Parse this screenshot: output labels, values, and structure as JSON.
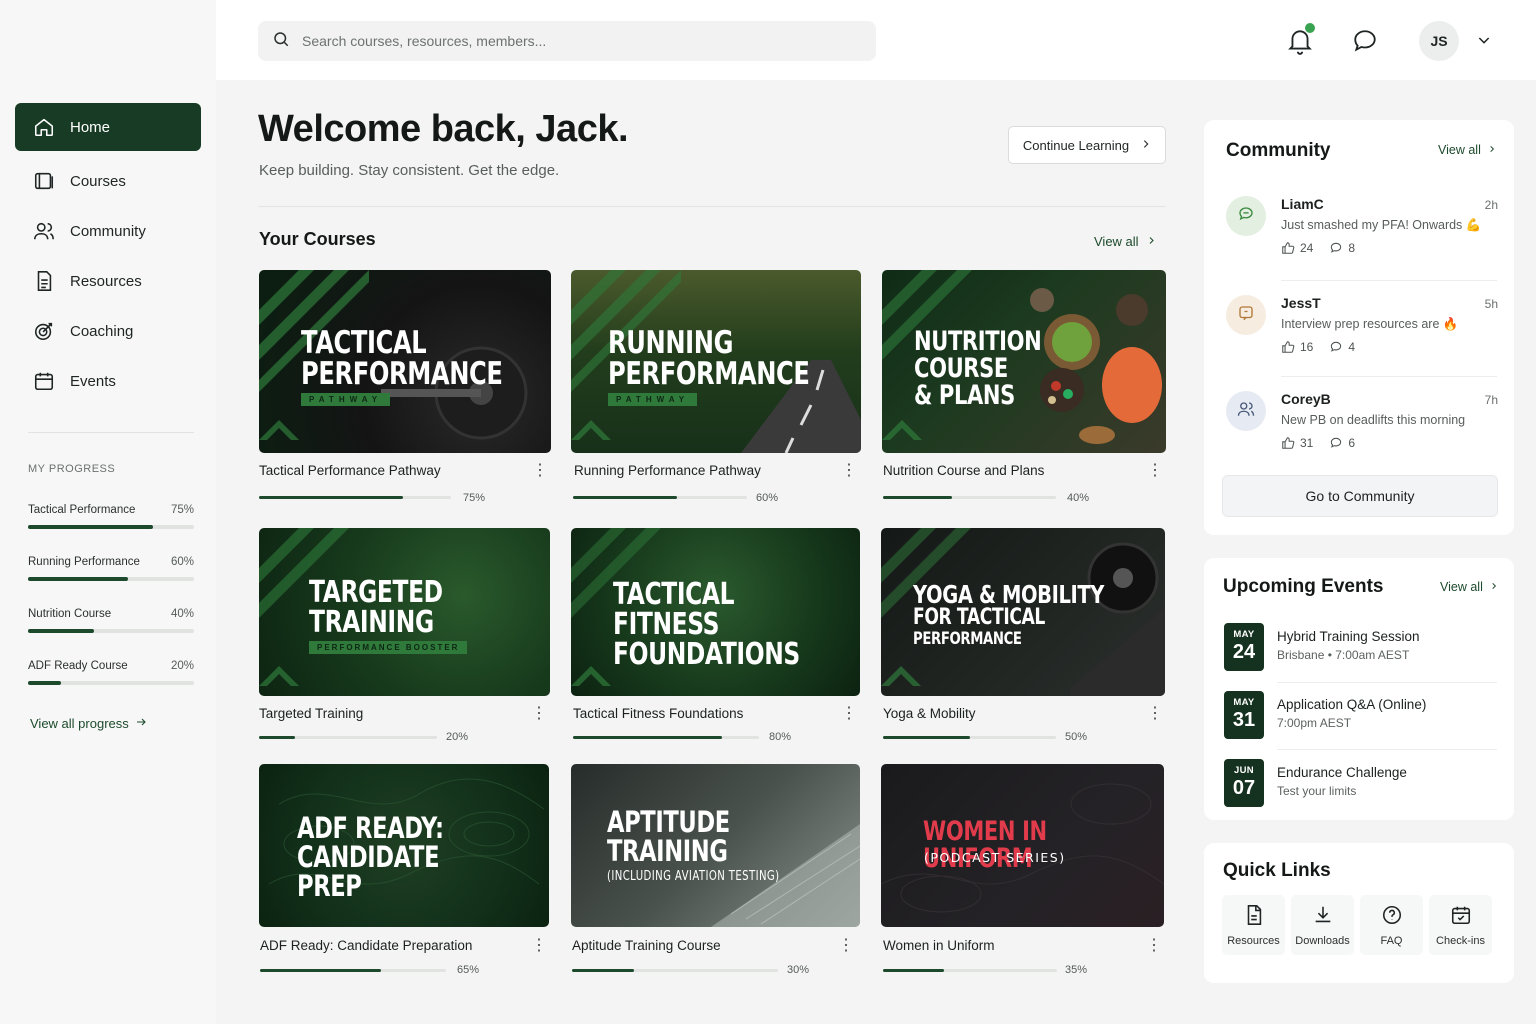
{
  "sidebar": {
    "nav": [
      {
        "label": "Home",
        "icon": "home-icon",
        "active": true
      },
      {
        "label": "Courses",
        "icon": "book-icon"
      },
      {
        "label": "Community",
        "icon": "users-icon"
      },
      {
        "label": "Resources",
        "icon": "document-icon"
      },
      {
        "label": "Coaching",
        "icon": "target-icon"
      },
      {
        "label": "Events",
        "icon": "calendar-icon"
      }
    ],
    "progress_heading": "MY PROGRESS",
    "progress": [
      {
        "label": "Tactical Performance",
        "pct_text": "75%",
        "value": 75
      },
      {
        "label": "Running Performance",
        "pct_text": "60%",
        "value": 60
      },
      {
        "label": "Nutrition Course",
        "pct_text": "40%",
        "value": 40
      },
      {
        "label": "ADF Ready Course",
        "pct_text": "20%",
        "value": 20
      }
    ],
    "view_progress": "View all progress"
  },
  "topbar": {
    "search_placeholder": "Search courses, resources, members...",
    "avatar_initials": "JS"
  },
  "main": {
    "welcome": "Welcome back, Jack.",
    "subtitle": "Keep building. Stay consistent. Get the edge.",
    "continue_label": "Continue Learning",
    "section_title": "Your Courses",
    "view_all": "View all",
    "courses": [
      {
        "thumb_lines": [
          "TACTICAL",
          "PERFORMANCE"
        ],
        "tag": "PATHWAY",
        "title": "Tactical Performance Pathway",
        "pct_text": "75%",
        "value": 75,
        "theme": "dark-green"
      },
      {
        "thumb_lines": [
          "RUNNING",
          "PERFORMANCE"
        ],
        "tag": "PATHWAY",
        "title": "Running Performance Pathway",
        "pct_text": "60%",
        "value": 60,
        "theme": "forest"
      },
      {
        "thumb_lines": [
          "NUTRITION",
          "COURSE",
          "& PLANS"
        ],
        "tag": "",
        "title": "Nutrition Course and Plans",
        "pct_text": "40%",
        "value": 40,
        "theme": "food"
      },
      {
        "thumb_lines": [
          "TARGETED",
          "TRAINING"
        ],
        "tag": "PERFORMANCE BOOSTER",
        "title": "Targeted Training",
        "pct_text": "20%",
        "value": 20,
        "theme": "green"
      },
      {
        "thumb_lines": [
          "TACTICAL FITNESS",
          "FOUNDATIONS"
        ],
        "tag": "",
        "title": "Tactical Fitness Foundations",
        "pct_text": "80%",
        "value": 80,
        "theme": "green"
      },
      {
        "thumb_lines": [
          "YOGA & MOBILITY",
          "FOR TACTICAL",
          "PERFORMANCE"
        ],
        "tag": "",
        "title": "Yoga & Mobility",
        "pct_text": "50%",
        "value": 50,
        "theme": "dark"
      },
      {
        "thumb_lines": [
          "ADF READY:",
          "CANDIDATE PREP"
        ],
        "tag": "",
        "title": "ADF Ready: Candidate Preparation",
        "pct_text": "65%",
        "value": 65,
        "theme": "topo-green"
      },
      {
        "thumb_lines": [
          "APTITUDE",
          "TRAINING",
          "(INCLUDING AVIATION TESTING)"
        ],
        "tag": "",
        "title": "Aptitude Training Course",
        "pct_text": "30%",
        "value": 30,
        "theme": "grey"
      },
      {
        "thumb_lines": [
          "WOMEN IN UNIFORM",
          "(PODCAST SERIES)"
        ],
        "tag": "",
        "title": "Women in Uniform",
        "pct_text": "35%",
        "value": 35,
        "theme": "black-red"
      }
    ]
  },
  "community": {
    "title": "Community",
    "view_all": "View all",
    "posts": [
      {
        "name": "LiamC",
        "time": "2h",
        "text": "Just smashed my PFA! Onwards 💪",
        "likes": "24",
        "comments": "8",
        "avatar_bg": "#e3efe0",
        "icon": "chat-bubble-icon"
      },
      {
        "name": "JessT",
        "time": "5h",
        "text": "Interview prep resources are 🔥",
        "likes": "16",
        "comments": "4",
        "avatar_bg": "#f6ece0",
        "icon": "message-icon"
      },
      {
        "name": "CoreyB",
        "time": "7h",
        "text": "New PB on deadlifts this morning",
        "likes": "31",
        "comments": "6",
        "avatar_bg": "#e6eaf2",
        "icon": "users-icon"
      }
    ],
    "button": "Go to Community"
  },
  "events": {
    "title": "Upcoming Events",
    "view_all": "View all",
    "items": [
      {
        "month": "MAY",
        "day": "24",
        "name": "Hybrid Training Session",
        "desc": "Brisbane  •  7:00am AEST"
      },
      {
        "month": "MAY",
        "day": "31",
        "name": "Application Q&A (Online)",
        "desc": "7:00pm AEST"
      },
      {
        "month": "JUN",
        "day": "07",
        "name": "Endurance Challenge",
        "desc": "Test your limits"
      }
    ]
  },
  "quick_links": {
    "title": "Quick Links",
    "items": [
      {
        "label": "Resources",
        "icon": "file-icon"
      },
      {
        "label": "Downloads",
        "icon": "download-icon"
      },
      {
        "label": "FAQ",
        "icon": "help-icon"
      },
      {
        "label": "Check-ins",
        "icon": "calendar-check-icon"
      }
    ]
  }
}
